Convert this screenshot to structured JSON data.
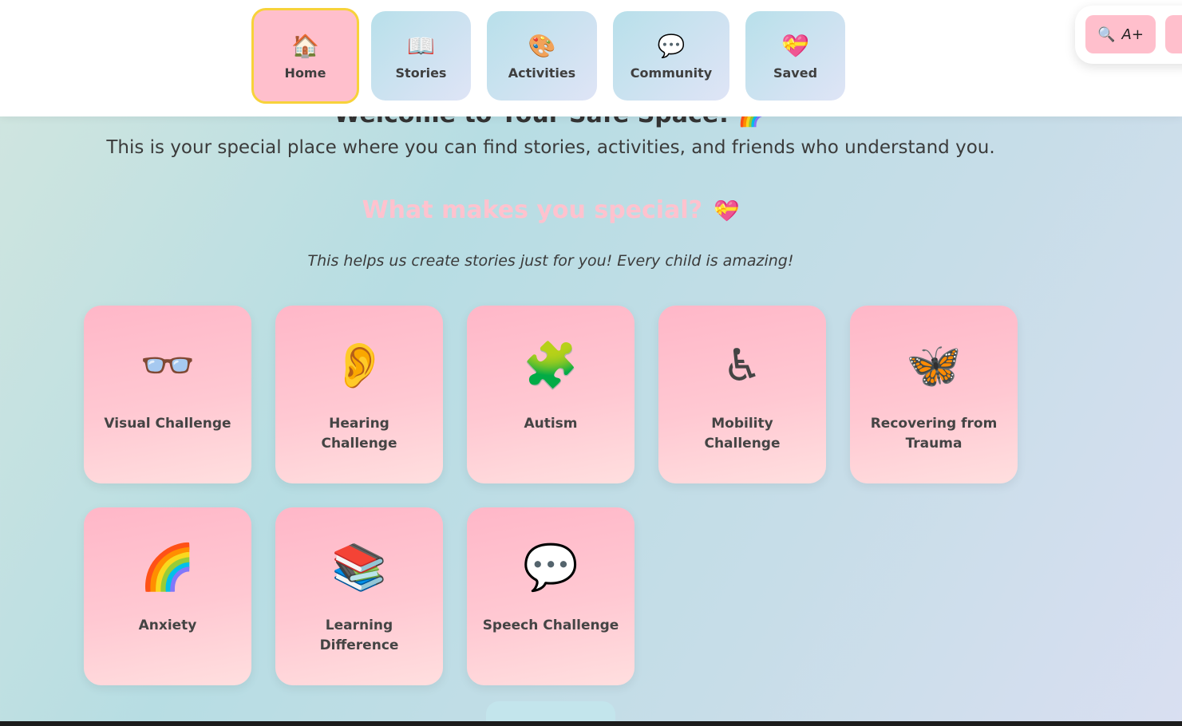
{
  "nav": {
    "items": [
      {
        "label": "Home",
        "icon": "🏠"
      },
      {
        "label": "Stories",
        "icon": "📖"
      },
      {
        "label": "Activities",
        "icon": "🎨"
      },
      {
        "label": "Community",
        "icon": "💬"
      },
      {
        "label": "Saved",
        "icon": "💝"
      }
    ]
  },
  "toolbar": {
    "zoom_label": "A+",
    "zoom_icon": "🔍"
  },
  "main": {
    "welcome": "Welcome to Your Safe Space! 🌈",
    "intro": "This is your special place where you can find stories, activities, and friends who understand you.",
    "special_title": "What makes you special?",
    "special_title_icon": "💝",
    "special_subtitle": "This helps us create stories just for you! Every child is amazing!"
  },
  "cards": [
    {
      "label": "Visual Challenge",
      "icon": "👓"
    },
    {
      "label": "Hearing Challenge",
      "icon": "👂"
    },
    {
      "label": "Autism",
      "icon": "🧩"
    },
    {
      "label": "Mobility Challenge",
      "icon": "♿"
    },
    {
      "label": "Recovering from Trauma",
      "icon": "🦋"
    },
    {
      "label": "Anxiety",
      "icon": "🌈"
    },
    {
      "label": "Learning Difference",
      "icon": "📚"
    },
    {
      "label": "Speech Challenge",
      "icon": "💬"
    }
  ],
  "colors": {
    "accent_pink": "#ffbfcc",
    "active_border": "#f7d23a",
    "nav_tile": "#b8e0ea",
    "title_pink": "#ffc2ce"
  }
}
